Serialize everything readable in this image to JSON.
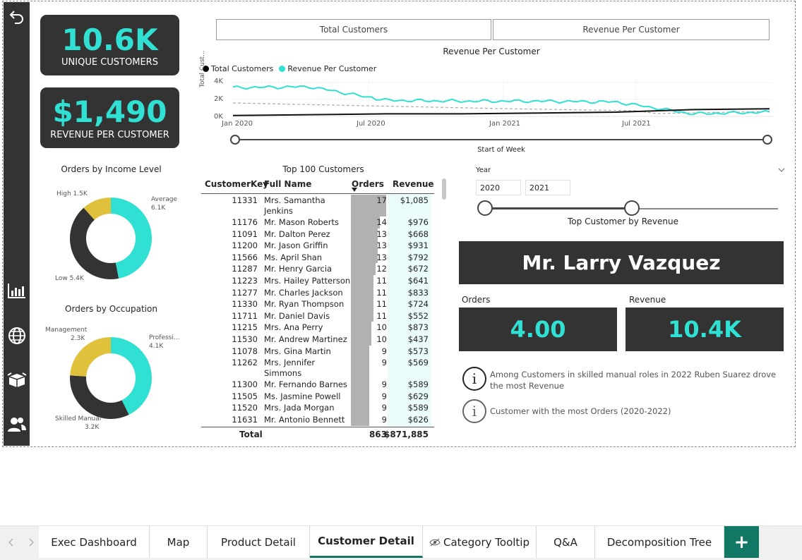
{
  "kpis": {
    "unique_customers_value": "10.6K",
    "unique_customers_label": "UNIQUE CUSTOMERS",
    "revenue_per_customer_value": "$1,490",
    "revenue_per_customer_label": "REVENUE PER CUSTOMER"
  },
  "toggle": {
    "left": "Total Customers",
    "right": "Revenue Per Customer"
  },
  "line_chart": {
    "title": "Revenue Per Customer",
    "legend": [
      "Total Customers",
      "Revenue Per Customer"
    ],
    "ylabel": "Total Cust...",
    "yticks": [
      "4K",
      "2K",
      "0K"
    ],
    "xticks": [
      "Jan 2020",
      "Jul 2020",
      "Jan 2021",
      "Jul 2021"
    ],
    "slider_label": "Start of Week"
  },
  "donut_income": {
    "title": "Orders by Income Level",
    "labels": {
      "high": "High 1.5K",
      "average_name": "Average",
      "average_value": "6.1K",
      "low": "Low 5.4K"
    }
  },
  "donut_occupation": {
    "title": "Orders by Occupation",
    "labels": {
      "mgmt_name": "Management",
      "mgmt_value": "2.3K",
      "prof_name": "Professi...",
      "prof_value": "4.1K",
      "skilled_name": "Skilled Manual",
      "skilled_value": "3.2K"
    }
  },
  "table": {
    "title": "Top 100 Customers",
    "headers": [
      "CustomerKey",
      "Full Name",
      "Orders",
      "Revenue"
    ],
    "rows": [
      {
        "key": "11331",
        "name": "Mrs. Samantha",
        "name2": "Jenkins",
        "orders": "17",
        "revenue": "$1,085"
      },
      {
        "key": "11176",
        "name": "Mr. Mason Roberts",
        "orders": "14",
        "revenue": "$976"
      },
      {
        "key": "11091",
        "name": "Mr. Dalton Perez",
        "orders": "13",
        "revenue": "$668"
      },
      {
        "key": "11200",
        "name": "Mr. Jason Griffin",
        "orders": "13",
        "revenue": "$931"
      },
      {
        "key": "11566",
        "name": "Ms. April Shan",
        "orders": "13",
        "revenue": "$792"
      },
      {
        "key": "11287",
        "name": "Mr. Henry Garcia",
        "orders": "12",
        "revenue": "$672"
      },
      {
        "key": "11223",
        "name": "Mrs. Hailey Patterson",
        "orders": "11",
        "revenue": "$641"
      },
      {
        "key": "11277",
        "name": "Mr. Charles Jackson",
        "orders": "11",
        "revenue": "$833"
      },
      {
        "key": "11330",
        "name": "Mr. Ryan Thompson",
        "orders": "11",
        "revenue": "$724"
      },
      {
        "key": "11711",
        "name": "Mr. Daniel Davis",
        "orders": "11",
        "revenue": "$552"
      },
      {
        "key": "11215",
        "name": "Mrs. Ana Perry",
        "orders": "10",
        "revenue": "$873"
      },
      {
        "key": "11530",
        "name": "Mr. Andrew Martinez",
        "orders": "10",
        "revenue": "$437"
      },
      {
        "key": "11078",
        "name": "Mrs. Gina Martin",
        "orders": "9",
        "revenue": "$573"
      },
      {
        "key": "11262",
        "name": "Mrs. Jennifer",
        "name2": "Simmons",
        "orders": "9",
        "revenue": "$569"
      },
      {
        "key": "11300",
        "name": "Mr. Fernando Barnes",
        "orders": "9",
        "revenue": "$589"
      },
      {
        "key": "11505",
        "name": "Ms. Jasmine Powell",
        "orders": "9",
        "revenue": "$629"
      },
      {
        "key": "11520",
        "name": "Mrs. Jada Morgan",
        "orders": "9",
        "revenue": "$589"
      },
      {
        "key": "11631",
        "name": "Mr. Antonio Bennett",
        "orders": "9",
        "revenue": "$626"
      }
    ],
    "total_label": "Total",
    "total_orders": "863",
    "total_revenue": "$871,885"
  },
  "year_slicer": {
    "title": "Year",
    "from": "2020",
    "to": "2021"
  },
  "top_customer": {
    "title": "Top Customer by Revenue",
    "name": "Mr. Larry Vazquez",
    "orders_label": "Orders",
    "orders_value": "4.00",
    "revenue_label": "Revenue",
    "revenue_value": "10.4K"
  },
  "insights": [
    "Among Customers in skilled manual roles in 2022 Ruben Suarez drove the most Revenue",
    "Customer with the most Orders (2020-2022)"
  ],
  "tabs": [
    "Exec Dashboard",
    "Map",
    "Product Detail",
    "Customer Detail",
    "Category Tooltip",
    "Q&A",
    "Decomposition Tree"
  ],
  "colors": {
    "accent": "#2fe0d3",
    "dark": "#333333",
    "gold": "#e0c13c",
    "active_tab": "#117865"
  },
  "chart_data": [
    {
      "type": "line",
      "title": "Revenue Per Customer",
      "ylabel": "Total Cust...",
      "x": [
        "Jan 2020",
        "Jul 2020",
        "Jan 2021",
        "Jul 2021"
      ],
      "ylim": [
        0,
        4000
      ],
      "series": [
        {
          "name": "Revenue Per Customer",
          "values": [
            3400,
            3500,
            1900,
            1800,
            1800,
            1700,
            300,
            500
          ]
        },
        {
          "name": "Total Customers",
          "values": [
            100,
            200,
            300,
            300,
            400,
            500,
            800,
            900
          ]
        }
      ]
    },
    {
      "type": "pie",
      "title": "Orders by Income Level",
      "categories": [
        "Average",
        "Low",
        "High"
      ],
      "values": [
        6100,
        5400,
        1500
      ]
    },
    {
      "type": "pie",
      "title": "Orders by Occupation",
      "categories": [
        "Professi...",
        "Skilled Manual",
        "Management"
      ],
      "values": [
        4100,
        3200,
        2300
      ]
    }
  ]
}
